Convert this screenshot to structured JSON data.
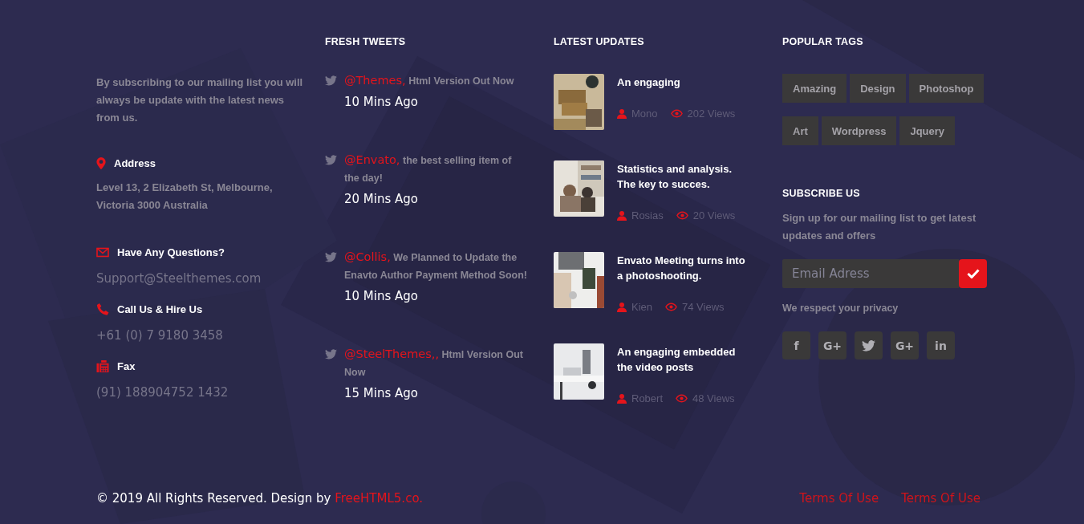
{
  "about": {
    "text": "By subscribing to our mailing list you will always be update with the latest news from us.",
    "contacts": [
      {
        "kind": "address",
        "label": "Address",
        "value": "Level 13, 2 Elizabeth St, Melbourne, Victoria 3000 Australia"
      },
      {
        "kind": "email",
        "label": "Have Any Questions?",
        "value": "Support@Steelthemes.com"
      },
      {
        "kind": "phone",
        "label": "Call Us & Hire Us",
        "value": "+61 (0) 7 9180 3458"
      },
      {
        "kind": "fax",
        "label": "Fax",
        "value": "(91) 188904752 1432"
      }
    ]
  },
  "tweets": {
    "title": "FRESH TWEETS",
    "items": [
      {
        "handle": "@Themes,",
        "text": "Html Version Out Now",
        "time": "10 Mins Ago"
      },
      {
        "handle": "@Envato,",
        "text": "the best selling item of the day!",
        "time": "20 Mins Ago"
      },
      {
        "handle": "@Collis,",
        "text": "We Planned to Update the Enavto Author Payment Method Soon!",
        "time": "10 Mins Ago"
      },
      {
        "handle": "@SteelThemes,,",
        "text": "Html Version Out Now",
        "time": "15 Mins Ago"
      }
    ]
  },
  "updates": {
    "title": "LATEST UPDATES",
    "items": [
      {
        "title": "An engaging",
        "author": "Mono",
        "views": "202 Views"
      },
      {
        "title": "Statistics and analysis. The key to succes.",
        "author": "Rosias",
        "views": "20 Views"
      },
      {
        "title": "Envato Meeting turns into a photoshooting.",
        "author": "Kien",
        "views": "74 Views"
      },
      {
        "title": "An engaging embedded the video posts",
        "author": "Robert",
        "views": "48 Views"
      }
    ]
  },
  "tags": {
    "title": "POPULAR TAGS",
    "items": [
      "Amazing",
      "Design",
      "Photoshop",
      "Art",
      "Wordpress",
      "Jquery"
    ]
  },
  "subscribe": {
    "title": "SUBSCRIBE US",
    "text": "Sign up for our mailing list to get latest updates and offers",
    "placeholder": "Email Adress",
    "note": "We respect your privacy",
    "social": [
      {
        "kind": "facebook",
        "label": "f"
      },
      {
        "kind": "gplus",
        "label": "G+"
      },
      {
        "kind": "twitter"
      },
      {
        "kind": "gplus",
        "label": "G+"
      },
      {
        "kind": "linkedin",
        "label": "in"
      }
    ]
  },
  "footer": {
    "copyright": "© 2019 All Rights Reserved. Design by",
    "credit": "FreeHTML5.co.",
    "links": [
      "Terms Of Use",
      "Terms Of Use"
    ]
  }
}
